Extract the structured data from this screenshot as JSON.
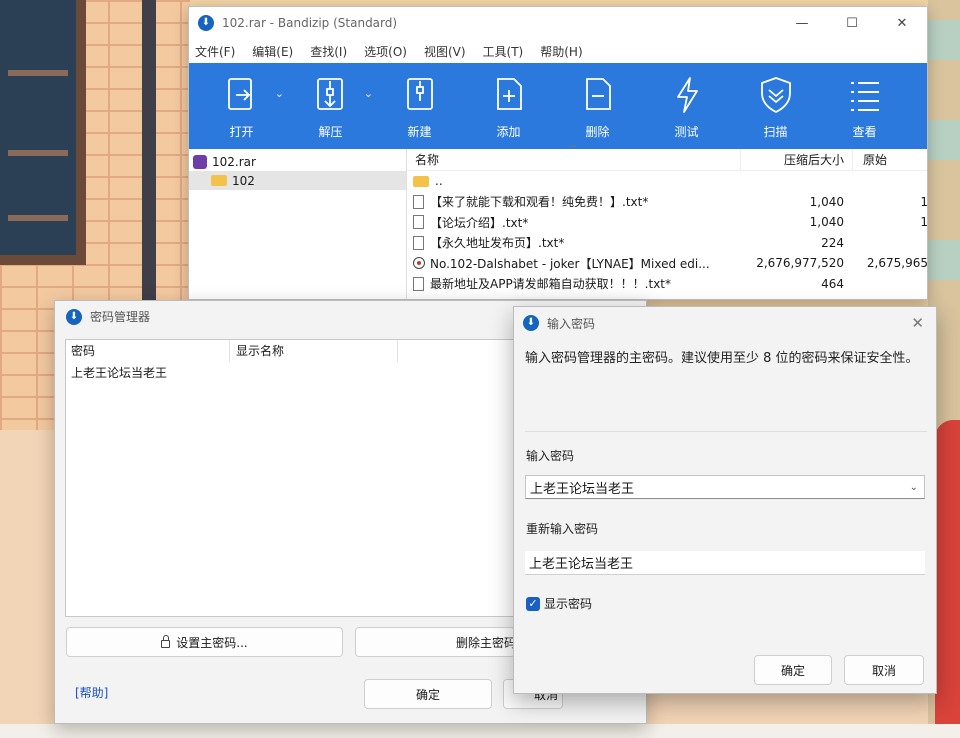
{
  "bandizip": {
    "title": "102.rar - Bandizip (Standard)",
    "window_controls": [
      "—",
      "☐",
      "✕"
    ],
    "menu": [
      "文件(F)",
      "编辑(E)",
      "查找(I)",
      "选项(O)",
      "视图(V)",
      "工具(T)",
      "帮助(H)"
    ],
    "toolbar": [
      {
        "label": "打开",
        "icon": "open-icon"
      },
      {
        "label": "解压",
        "icon": "extract-icon"
      },
      {
        "label": "新建",
        "icon": "new-archive-icon"
      },
      {
        "label": "添加",
        "icon": "add-icon"
      },
      {
        "label": "删除",
        "icon": "delete-icon"
      },
      {
        "label": "测试",
        "icon": "test-icon"
      },
      {
        "label": "扫描",
        "icon": "scan-shield-icon"
      },
      {
        "label": "查看",
        "icon": "view-list-icon"
      }
    ],
    "tree": {
      "root": "102.rar",
      "child": "102"
    },
    "columns": {
      "name": "名称",
      "compressed": "压缩后大小",
      "original": "原始"
    },
    "files": [
      {
        "name": "..",
        "compressed": "",
        "original": "",
        "icon": "folder-icon"
      },
      {
        "name": "【来了就能下载和观看！纯免费！】.txt*",
        "compressed": "1,040",
        "original": "1",
        "icon": "text-file-icon"
      },
      {
        "name": "【论坛介绍】.txt*",
        "compressed": "1,040",
        "original": "1",
        "icon": "text-file-icon"
      },
      {
        "name": "【永久地址发布页】.txt*",
        "compressed": "224",
        "original": "",
        "icon": "text-file-icon"
      },
      {
        "name": "No.102-Dalshabet - joker【LYNAE】Mixed edi...",
        "compressed": "2,676,977,520",
        "original": "2,675,965",
        "icon": "video-file-icon"
      },
      {
        "name": "最新地址及APP请发邮箱自动获取！！！.txt*",
        "compressed": "464",
        "original": "",
        "icon": "text-file-icon"
      }
    ]
  },
  "password_manager": {
    "title": "密码管理器",
    "columns": {
      "password": "密码",
      "display_name": "显示名称"
    },
    "rows": [
      {
        "password": "上老王论坛当老王",
        "display_name": ""
      }
    ],
    "set_master_button": "设置主密码...",
    "delete_master_button": "删除主密码",
    "help_link": "[帮助]",
    "ok_button": "确定",
    "cancel_button": "取消"
  },
  "enter_password": {
    "title": "输入密码",
    "description": "输入密码管理器的主密码。建议使用至少 8 位的密码来保证安全性。",
    "password_label": "输入密码",
    "password_value": "上老王论坛当老王",
    "confirm_label": "重新输入密码",
    "confirm_value": "上老王论坛当老王",
    "show_password_label": "显示密码",
    "show_password_checked": true,
    "ok_button": "确定",
    "cancel_button": "取消"
  },
  "colors": {
    "toolbar_blue": "#2b79dd",
    "checkbox_blue": "#1a5fc4",
    "link_blue": "#1a4fc4"
  }
}
